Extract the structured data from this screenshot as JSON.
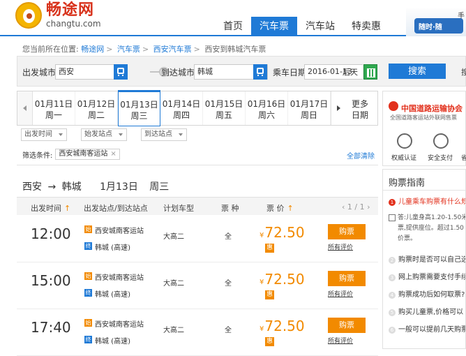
{
  "header": {
    "logo_cn": "畅途网",
    "logo_en": "changtu.com",
    "nav": [
      {
        "label": "首页",
        "active": false
      },
      {
        "label": "汽车票",
        "active": true
      },
      {
        "label": "汽车站",
        "active": false
      },
      {
        "label": "特卖惠",
        "active": false
      }
    ],
    "ad_bus_text": "随时·随",
    "ad_hint": "手"
  },
  "breadcrumb": {
    "prefix": "您当前所在位置:",
    "items": [
      "畅途网",
      "汽车票",
      "西安汽车票"
    ],
    "current": "西安到韩城汽车票"
  },
  "search": {
    "from_label": "出发城市",
    "from_value": "西安",
    "to_label": "到达城市",
    "to_value": "韩城",
    "date_label": "乘车日期",
    "date_value": "2016-01-13",
    "date_day": "后天",
    "button": "搜索",
    "extra": "搜"
  },
  "dates": [
    {
      "date": "01月11日",
      "weekday": "周一",
      "active": false
    },
    {
      "date": "01月12日",
      "weekday": "周二",
      "active": false
    },
    {
      "date": "01月13日",
      "weekday": "周三",
      "active": true
    },
    {
      "date": "01月14日",
      "weekday": "周四",
      "active": false
    },
    {
      "date": "01月15日",
      "weekday": "周五",
      "active": false
    },
    {
      "date": "01月16日",
      "weekday": "周六",
      "active": false
    },
    {
      "date": "01月17日",
      "weekday": "周日",
      "active": false
    }
  ],
  "more_dates": {
    "line1": "更多",
    "line2": "日期"
  },
  "filters": [
    "出发时间",
    "始发站点",
    "到达站点"
  ],
  "conditions": {
    "label": "筛选条件:",
    "chip": "西安城南客运站",
    "chip_close": "×",
    "clear_all": "全部清除"
  },
  "route": {
    "from": "西安",
    "arrow": "→",
    "to": "韩城",
    "date": "1月13日",
    "weekday": "周三"
  },
  "table": {
    "headers": {
      "time": "出发时间",
      "stations": "出发站点/到达站点",
      "type": "计划车型",
      "kind": "票 种",
      "price": "票 价",
      "sort_arrow": "↑"
    },
    "pager": "‹   1 / 1   ›",
    "rows": [
      {
        "time": "12:00",
        "start_badge": "始",
        "start": "西安城南客运站",
        "end_badge": "终",
        "end": "韩城 (高速)",
        "type": "大高二",
        "kind": "全",
        "currency": "¥",
        "price": "72.50",
        "discount": "惠",
        "buy": "购票",
        "review": "所有评价"
      },
      {
        "time": "15:00",
        "start_badge": "始",
        "start": "西安城南客运站",
        "end_badge": "终",
        "end": "韩城 (高速)",
        "type": "大高二",
        "kind": "全",
        "currency": "¥",
        "price": "72.50",
        "discount": "惠",
        "buy": "购票",
        "review": "所有评价"
      },
      {
        "time": "17:40",
        "start_badge": "始",
        "start": "西安城南客运站",
        "end_badge": "终",
        "end": "韩城 (高速)",
        "type": "大高二",
        "kind": "全",
        "currency": "¥",
        "price": "72.50",
        "discount": "惠",
        "buy": "购票",
        "review": "所有评价"
      }
    ]
  },
  "sidebar": {
    "association_title": "中国道路运输协会",
    "association_sub": "全国道路客运站外联网售票",
    "trust": [
      "权威认证",
      "安全支付",
      "省"
    ],
    "guide_title": "购票指南",
    "questions": [
      {
        "num": "1",
        "text": "儿童乘车购票有什么规",
        "hot": true
      },
      {
        "num": "2",
        "text": "购票时是否可以自己选",
        "hot": false
      },
      {
        "num": "3",
        "text": "网上购票需要支付手续",
        "hot": false
      },
      {
        "num": "4",
        "text": "购票成功后如何取票?",
        "hot": false
      },
      {
        "num": "5",
        "text": "购买儿童票,价格可以",
        "hot": false
      },
      {
        "num": "6",
        "text": "一般可以提前几天购票",
        "hot": false
      }
    ],
    "answer_lines": [
      "答:儿童身高1.20-1.50米",
      "票,提供座位。超过1.50",
      "价票。"
    ]
  }
}
